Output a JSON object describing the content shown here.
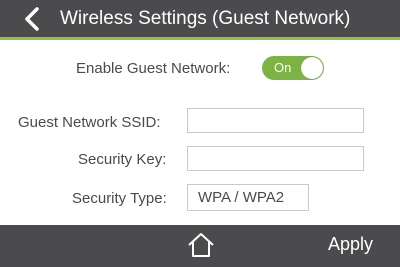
{
  "header": {
    "title": "Wireless Settings (Guest Network)",
    "back_icon": "chevron-left-icon"
  },
  "form": {
    "enable_label": "Enable Guest Network:",
    "toggle_state": "On",
    "ssid_label": "Guest Network SSID:",
    "ssid_value": "",
    "key_label": "Security Key:",
    "key_value": "",
    "security_type_label": "Security Type:",
    "security_type_value": "WPA / WPA2"
  },
  "footer": {
    "home_icon": "home-icon",
    "apply_label": "Apply"
  },
  "colors": {
    "header_bg": "#4b4b4d",
    "accent": "#8cc63f",
    "toggle_on": "#7cb342"
  }
}
